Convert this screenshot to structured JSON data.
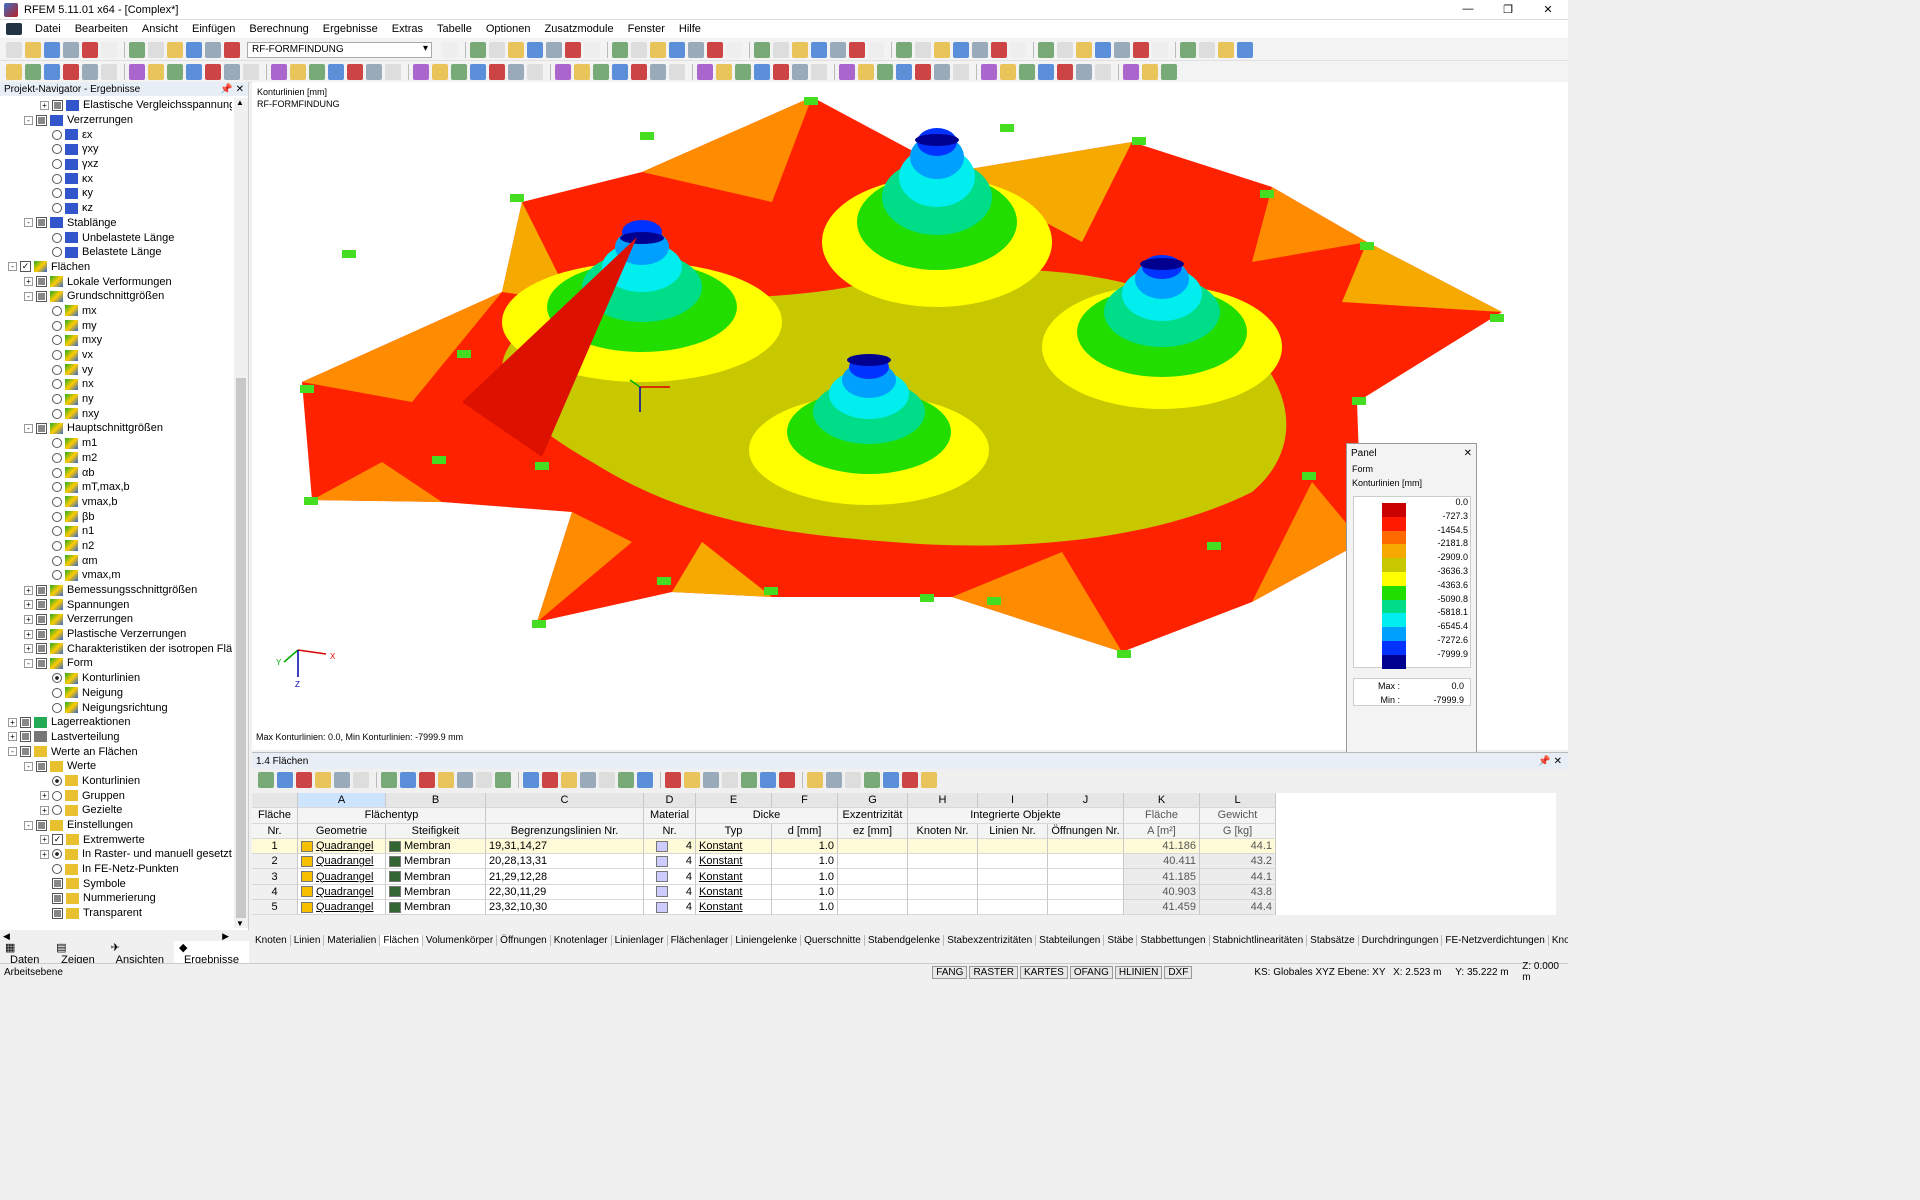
{
  "window": {
    "title": "RFEM 5.11.01 x64 - [Complex*]",
    "min": "—",
    "max": "❐",
    "close": "✕"
  },
  "menu": [
    "Datei",
    "Bearbeiten",
    "Ansicht",
    "Einfügen",
    "Berechnung",
    "Ergebnisse",
    "Extras",
    "Tabelle",
    "Optionen",
    "Zusatzmodule",
    "Fenster",
    "Hilfe"
  ],
  "mdi": [
    "–",
    "❐",
    "✕"
  ],
  "toolbar": {
    "combo": "RF-FORMFINDUNG"
  },
  "navigator": {
    "title": "Projekt-Navigator - Ergebnisse",
    "pin": "📌",
    "close": "✕",
    "scroll_left": "◀",
    "scroll_right": "▶",
    "scroll_up": "▲",
    "scroll_down": "▼",
    "tabs": [
      "Daten",
      "Zeigen",
      "Ansichten",
      "Ergebnisse"
    ],
    "items": [
      {
        "d": 2,
        "t": "+",
        "k": "c",
        "i": "blue",
        "label": "Elastische Vergleichsspannungen"
      },
      {
        "d": 1,
        "t": "-",
        "k": "c",
        "i": "blue",
        "label": "Verzerrungen"
      },
      {
        "d": 2,
        "k": "r",
        "i": "blue",
        "label": "εx"
      },
      {
        "d": 2,
        "k": "r",
        "i": "blue",
        "label": "γxy"
      },
      {
        "d": 2,
        "k": "r",
        "i": "blue",
        "label": "γxz"
      },
      {
        "d": 2,
        "k": "r",
        "i": "blue",
        "label": "κx"
      },
      {
        "d": 2,
        "k": "r",
        "i": "blue",
        "label": "κy"
      },
      {
        "d": 2,
        "k": "r",
        "i": "blue",
        "label": "κz"
      },
      {
        "d": 1,
        "t": "-",
        "k": "c",
        "i": "blue",
        "label": "Stablänge"
      },
      {
        "d": 2,
        "k": "r",
        "i": "blue",
        "label": "Unbelastete Länge"
      },
      {
        "d": 2,
        "k": "r",
        "i": "blue",
        "label": "Belastete Länge"
      },
      {
        "d": 0,
        "t": "-",
        "k": "cc",
        "i": "surf",
        "label": "Flächen"
      },
      {
        "d": 1,
        "t": "+",
        "k": "c",
        "i": "surf",
        "label": "Lokale Verformungen"
      },
      {
        "d": 1,
        "t": "-",
        "k": "c",
        "i": "surf",
        "label": "Grundschnittgrößen"
      },
      {
        "d": 2,
        "k": "r",
        "i": "surf",
        "label": "mx"
      },
      {
        "d": 2,
        "k": "r",
        "i": "surf",
        "label": "my"
      },
      {
        "d": 2,
        "k": "r",
        "i": "surf",
        "label": "mxy"
      },
      {
        "d": 2,
        "k": "r",
        "i": "surf",
        "label": "vx"
      },
      {
        "d": 2,
        "k": "r",
        "i": "surf",
        "label": "vy"
      },
      {
        "d": 2,
        "k": "r",
        "i": "surf",
        "label": "nx"
      },
      {
        "d": 2,
        "k": "r",
        "i": "surf",
        "label": "ny"
      },
      {
        "d": 2,
        "k": "r",
        "i": "surf",
        "label": "nxy"
      },
      {
        "d": 1,
        "t": "-",
        "k": "c",
        "i": "surf",
        "label": "Hauptschnittgrößen"
      },
      {
        "d": 2,
        "k": "r",
        "i": "surf",
        "label": "m1"
      },
      {
        "d": 2,
        "k": "r",
        "i": "surf",
        "label": "m2"
      },
      {
        "d": 2,
        "k": "r",
        "i": "surf",
        "label": "αb"
      },
      {
        "d": 2,
        "k": "r",
        "i": "surf",
        "label": "mT,max,b"
      },
      {
        "d": 2,
        "k": "r",
        "i": "surf",
        "label": "vmax,b"
      },
      {
        "d": 2,
        "k": "r",
        "i": "surf",
        "label": "βb"
      },
      {
        "d": 2,
        "k": "r",
        "i": "surf",
        "label": "n1"
      },
      {
        "d": 2,
        "k": "r",
        "i": "surf",
        "label": "n2"
      },
      {
        "d": 2,
        "k": "r",
        "i": "surf",
        "label": "αm"
      },
      {
        "d": 2,
        "k": "r",
        "i": "surf",
        "label": "vmax,m"
      },
      {
        "d": 1,
        "t": "+",
        "k": "c",
        "i": "surf",
        "label": "Bemessungsschnittgrößen"
      },
      {
        "d": 1,
        "t": "+",
        "k": "c",
        "i": "surf",
        "label": "Spannungen"
      },
      {
        "d": 1,
        "t": "+",
        "k": "c",
        "i": "surf",
        "label": "Verzerrungen"
      },
      {
        "d": 1,
        "t": "+",
        "k": "c",
        "i": "surf",
        "label": "Plastische Verzerrungen"
      },
      {
        "d": 1,
        "t": "+",
        "k": "c",
        "i": "surf",
        "label": "Charakteristiken der isotropen Fläche"
      },
      {
        "d": 1,
        "t": "-",
        "k": "c",
        "i": "surf",
        "label": "Form"
      },
      {
        "d": 2,
        "k": "ron",
        "i": "surf",
        "label": "Konturlinien"
      },
      {
        "d": 2,
        "k": "r",
        "i": "surf",
        "label": "Neigung"
      },
      {
        "d": 2,
        "k": "r",
        "i": "surf",
        "label": "Neigungsrichtung"
      },
      {
        "d": 0,
        "t": "+",
        "k": "c",
        "i": "sup",
        "label": "Lagerreaktionen"
      },
      {
        "d": 0,
        "t": "+",
        "k": "c",
        "i": "load",
        "label": "Lastverteilung"
      },
      {
        "d": 0,
        "t": "-",
        "k": "c",
        "i": "val",
        "label": "Werte an Flächen"
      },
      {
        "d": 1,
        "t": "-",
        "k": "c",
        "i": "val",
        "label": "Werte"
      },
      {
        "d": 2,
        "k": "ron",
        "i": "val",
        "label": "Konturlinien"
      },
      {
        "d": 2,
        "t": "+",
        "k": "r",
        "i": "val",
        "label": "Gruppen"
      },
      {
        "d": 2,
        "t": "+",
        "k": "r",
        "i": "val",
        "label": "Gezielte"
      },
      {
        "d": 1,
        "t": "-",
        "k": "c",
        "i": "val",
        "label": "Einstellungen"
      },
      {
        "d": 2,
        "t": "+",
        "k": "cc",
        "i": "val",
        "label": "Extremwerte"
      },
      {
        "d": 2,
        "t": "+",
        "k": "ron",
        "i": "val",
        "label": "In Raster- und manuell gesetzten P"
      },
      {
        "d": 2,
        "k": "r",
        "i": "val",
        "label": "In FE-Netz-Punkten"
      },
      {
        "d": 2,
        "k": "c",
        "i": "val",
        "label": "Symbole"
      },
      {
        "d": 2,
        "k": "c",
        "i": "val",
        "label": "Nummerierung"
      },
      {
        "d": 2,
        "k": "c",
        "i": "val",
        "label": "Transparent"
      }
    ]
  },
  "viewport": {
    "label1": "Konturlinien [mm]",
    "label2": "RF-FORMFINDUNG",
    "footer": "Max Konturlinien: 0.0, Min Konturlinien: -7999.9 mm",
    "axis_x": "X",
    "axis_y": "Y",
    "axis_z": "Z"
  },
  "panel": {
    "title": "Panel",
    "close": "✕",
    "l1": "Form",
    "l2": "Konturlinien [mm]",
    "values": [
      "0.0",
      "-727.3",
      "-1454.5",
      "-2181.8",
      "-2909.0",
      "-3636.3",
      "-4363.6",
      "-5090.8",
      "-5818.1",
      "-6545.4",
      "-7272.6",
      "-7999.9"
    ],
    "colors": [
      "#c80000",
      "#ff1a00",
      "#ff6a00",
      "#f6a900",
      "#c8c800",
      "#ffff00",
      "#22dd00",
      "#00dd88",
      "#00eeee",
      "#00a0ff",
      "#0033ff",
      "#000090"
    ],
    "max_label": "Max  :",
    "max_val": "0.0",
    "min_label": "Min  :",
    "min_val": "-7999.9"
  },
  "table": {
    "title": "1.4 Flächen",
    "pin": "📌",
    "close": "✕",
    "letters": [
      "",
      "A",
      "B",
      "C",
      "D",
      "E",
      "F",
      "G",
      "H",
      "I",
      "J",
      "K",
      "L"
    ],
    "h1": [
      "Fläche",
      "Flächentyp",
      "",
      "Material",
      "Dicke",
      "",
      "Exzentrizität",
      "",
      "Integrierte Objekte",
      "",
      "Fläche",
      "Gewicht"
    ],
    "h2": [
      "Nr.",
      "Geometrie",
      "Steifigkeit",
      "Begrenzungslinien Nr.",
      "Nr.",
      "Typ",
      "d [mm]",
      "ez [mm]",
      "Knoten Nr.",
      "Linien Nr.",
      "Öffnungen Nr.",
      "A [m²]",
      "G [kg]"
    ],
    "rows": [
      [
        "1",
        "Quadrangel",
        "Membran",
        "19,31,14,27",
        "4",
        "Konstant",
        "1.0",
        "41.186",
        "44.1"
      ],
      [
        "2",
        "Quadrangel",
        "Membran",
        "20,28,13,31",
        "4",
        "Konstant",
        "1.0",
        "40.411",
        "43.2"
      ],
      [
        "3",
        "Quadrangel",
        "Membran",
        "21,29,12,28",
        "4",
        "Konstant",
        "1.0",
        "41.185",
        "44.1"
      ],
      [
        "4",
        "Quadrangel",
        "Membran",
        "22,30,11,29",
        "4",
        "Konstant",
        "1.0",
        "40.903",
        "43.8"
      ],
      [
        "5",
        "Quadrangel",
        "Membran",
        "23,32,10,30",
        "4",
        "Konstant",
        "1.0",
        "41.459",
        "44.4"
      ]
    ],
    "tabs": [
      "Knoten",
      "Linien",
      "Materialien",
      "Flächen",
      "Volumenkörper",
      "Öffnungen",
      "Knotenlager",
      "Linienlager",
      "Flächenlager",
      "Liniengelenke",
      "Querschnitte",
      "Stabendgelenke",
      "Stabexzentrizitäten",
      "Stabteilungen",
      "Stäbe",
      "Stabbettungen",
      "Stabnichtlinearitäten",
      "Stabsätze",
      "Durchdringungen",
      "FE-Netzverdichtungen",
      "Knotenfreigaben"
    ],
    "nav": [
      "|◀",
      "◀",
      "▶",
      "▶|"
    ]
  },
  "status": {
    "left": "Arbeitsebene",
    "buttons": [
      "FANG",
      "RASTER",
      "KARTES",
      "OFANG",
      "HLINIEN",
      "DXF"
    ],
    "ks": "KS: Globales XYZ  Ebene: XY",
    "x": "X:  2.523 m",
    "y": "Y:  35.222 m",
    "z": "Z:  0.000 m"
  }
}
